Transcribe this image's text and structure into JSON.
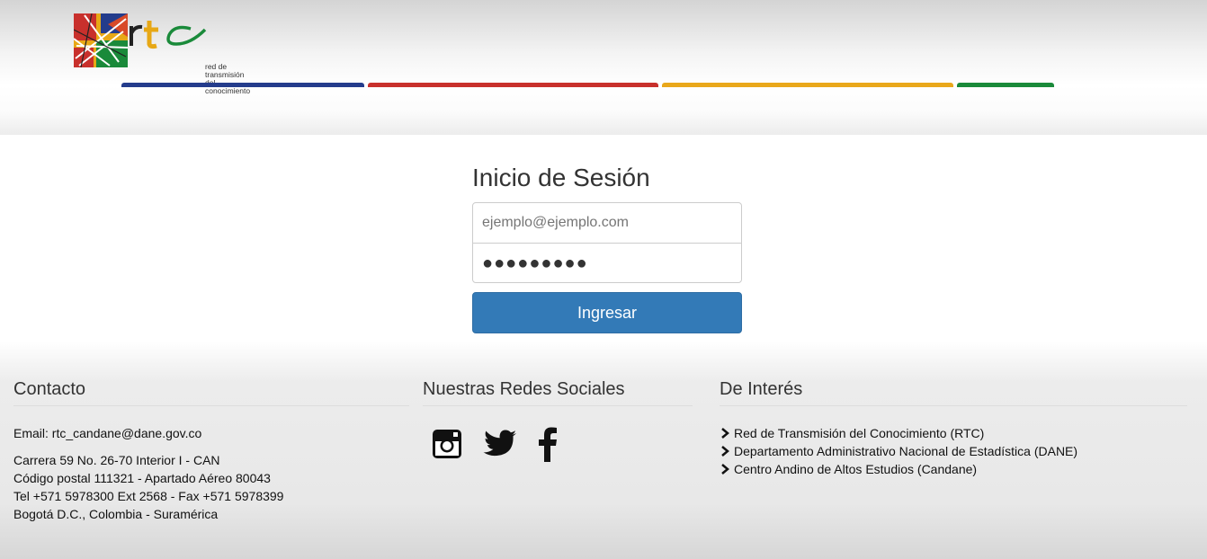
{
  "brand": {
    "name": "rtc",
    "tagline_line1": "red de transmisión",
    "tagline_line2": "del conocimiento"
  },
  "nav_colors": [
    "#243c8c",
    "#c8302c",
    "#e9a81b",
    "#1a8a3a"
  ],
  "login": {
    "title": "Inicio de Sesión",
    "email_placeholder": "ejemplo@ejemplo.com",
    "password_mask": "●●●●●●●●●",
    "submit_label": "Ingresar"
  },
  "footer": {
    "contact": {
      "heading": "Contacto",
      "email": "Email: rtc_candane@dane.gov.co",
      "address_1": "Carrera 59 No. 26-70 Interior I - CAN",
      "address_2": "Código postal 111321 - Apartado Aéreo 80043",
      "phone": "Tel +571 5978300 Ext 2568 - Fax +571 5978399",
      "city": "Bogotá D.C., Colombia - Suramérica"
    },
    "social": {
      "heading": "Nuestras Redes Sociales",
      "icons": [
        "instagram-icon",
        "twitter-icon",
        "facebook-icon"
      ]
    },
    "interest": {
      "heading": "De Interés",
      "links": [
        "Red de Transmisión del Conocimiento (RTC)",
        "Departamento Administrativo Nacional de Estadística (DANE)",
        "Centro Andino de Altos Estudios (Candane)"
      ]
    }
  },
  "colors": {
    "primary_button": "#337ab7"
  }
}
